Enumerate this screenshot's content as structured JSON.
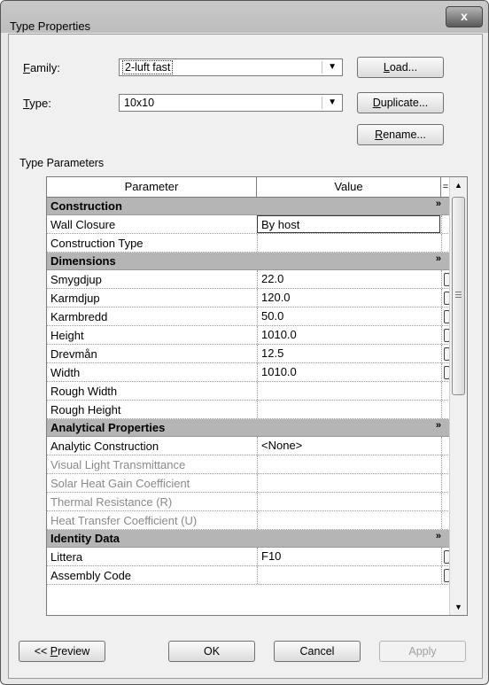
{
  "window": {
    "title": "Type Properties",
    "close_label": "x"
  },
  "family": {
    "label": "Family:",
    "value": "2-luft fast"
  },
  "type": {
    "label": "Type:",
    "value": "10x10"
  },
  "buttons": {
    "load": "Load...",
    "duplicate": "Duplicate...",
    "rename": "Rename..."
  },
  "type_parameters_label": "Type Parameters",
  "grid": {
    "headers": {
      "parameter": "Parameter",
      "value": "Value",
      "eq": "="
    },
    "collapse_glyph": "»",
    "groups": [
      {
        "name": "Construction",
        "rows": [
          {
            "param": "Wall Closure",
            "value": "By host",
            "selected": true,
            "has_button": false,
            "disabled": false
          },
          {
            "param": "Construction Type",
            "value": "",
            "selected": false,
            "has_button": false,
            "disabled": false
          }
        ]
      },
      {
        "name": "Dimensions",
        "rows": [
          {
            "param": "Smygdjup",
            "value": "22.0",
            "selected": false,
            "has_button": true,
            "disabled": false
          },
          {
            "param": "Karmdjup",
            "value": "120.0",
            "selected": false,
            "has_button": true,
            "disabled": false
          },
          {
            "param": "Karmbredd",
            "value": "50.0",
            "selected": false,
            "has_button": true,
            "disabled": false
          },
          {
            "param": "Height",
            "value": "1010.0",
            "selected": false,
            "has_button": true,
            "disabled": false
          },
          {
            "param": "Drevmån",
            "value": "12.5",
            "selected": false,
            "has_button": true,
            "disabled": false
          },
          {
            "param": "Width",
            "value": "1010.0",
            "selected": false,
            "has_button": true,
            "disabled": false
          },
          {
            "param": "Rough Width",
            "value": "",
            "selected": false,
            "has_button": false,
            "disabled": false
          },
          {
            "param": "Rough Height",
            "value": "",
            "selected": false,
            "has_button": false,
            "disabled": false
          }
        ]
      },
      {
        "name": "Analytical Properties",
        "rows": [
          {
            "param": "Analytic Construction",
            "value": "<None>",
            "selected": false,
            "has_button": false,
            "disabled": false
          },
          {
            "param": "Visual Light Transmittance",
            "value": "",
            "selected": false,
            "has_button": false,
            "disabled": true
          },
          {
            "param": "Solar Heat Gain Coefficient",
            "value": "",
            "selected": false,
            "has_button": false,
            "disabled": true
          },
          {
            "param": "Thermal Resistance (R)",
            "value": "",
            "selected": false,
            "has_button": false,
            "disabled": true
          },
          {
            "param": "Heat Transfer Coefficient (U)",
            "value": "",
            "selected": false,
            "has_button": false,
            "disabled": true
          }
        ]
      },
      {
        "name": "Identity Data",
        "rows": [
          {
            "param": "Littera",
            "value": "F10",
            "selected": false,
            "has_button": true,
            "disabled": false
          },
          {
            "param": "Assembly Code",
            "value": "",
            "selected": false,
            "has_button": true,
            "disabled": false
          }
        ]
      }
    ]
  },
  "footer": {
    "preview": "<< Preview",
    "ok": "OK",
    "cancel": "Cancel",
    "apply": "Apply"
  },
  "icons": {
    "close": "close-icon",
    "dropdown": "chevron-down-icon",
    "collapse": "collapse-icon",
    "scroll_up": "scroll-up-icon",
    "scroll_down": "scroll-down-icon"
  }
}
